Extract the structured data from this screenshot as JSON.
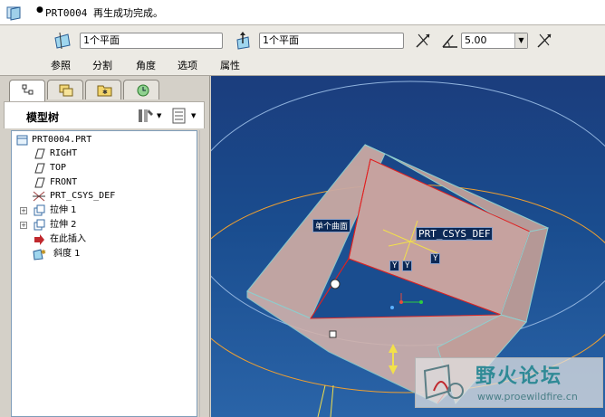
{
  "message_bar": {
    "bullet": "●",
    "text": "PRT0004 再生成功完成。"
  },
  "dashboard": {
    "field_1": "1个平面",
    "field_2": "1个平面",
    "angle_value": "5.00",
    "tabs": [
      "参照",
      "分割",
      "角度",
      "选项",
      "属性"
    ]
  },
  "left_panel": {
    "tree_title": "模型树",
    "tree_items": [
      {
        "label": "PRT0004.PRT",
        "icon": "part-icon"
      },
      {
        "label": "RIGHT",
        "icon": "datum-plane-icon"
      },
      {
        "label": "TOP",
        "icon": "datum-plane-icon"
      },
      {
        "label": "FRONT",
        "icon": "datum-plane-icon"
      },
      {
        "label": "PRT_CSYS_DEF",
        "icon": "csys-icon"
      },
      {
        "label": "拉伸 1",
        "icon": "extrude-icon"
      },
      {
        "label": "拉伸 2",
        "icon": "extrude-icon"
      },
      {
        "label": "在此插入",
        "icon": "insert-here-icon"
      },
      {
        "label": "斜度 1",
        "icon": "draft-icon"
      }
    ]
  },
  "viewport": {
    "label_surface": "单个曲面",
    "label_csys": "PRT_CSYS_DEF",
    "axis_y1": "Y",
    "axis_y2": "Y",
    "axis_y3": "Y"
  },
  "watermark": {
    "title": "野火论坛",
    "url": "www.proewildfire.cn"
  },
  "colors": {
    "viewport_top": "#1b3d7d",
    "viewport_bottom": "#2a64a8",
    "model_fill": "#c9a9a3",
    "edge_red": "#e02020",
    "datum_orange": "#f0a030"
  }
}
